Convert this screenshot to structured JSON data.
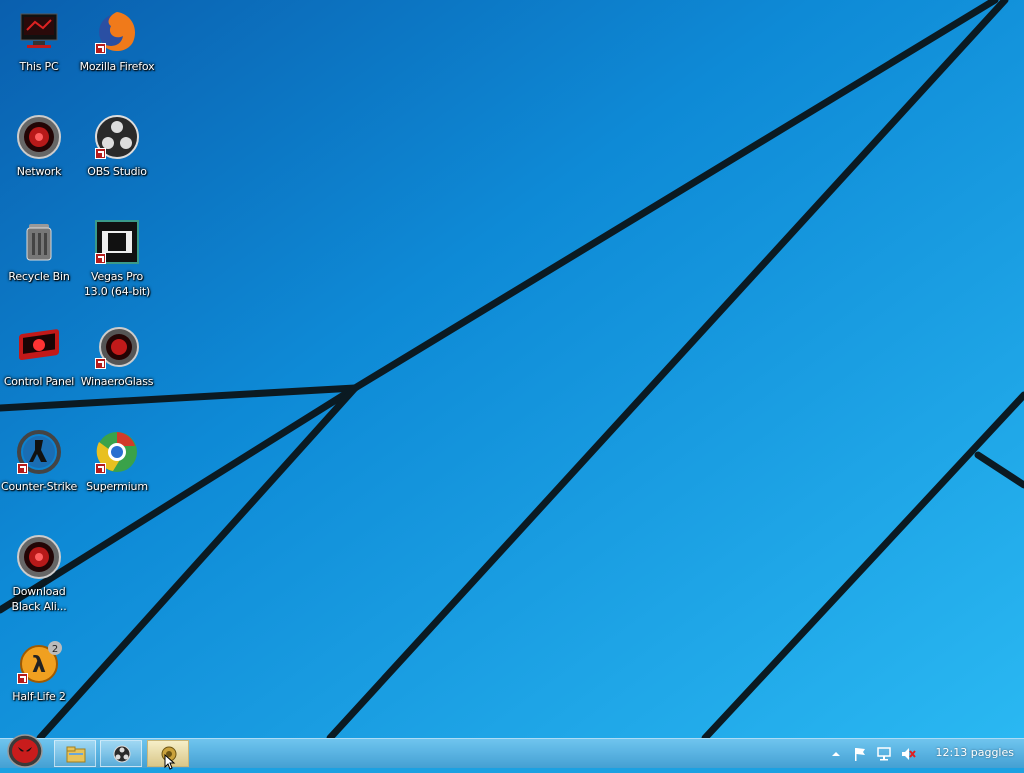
{
  "desktop": {
    "icons": [
      {
        "label": "This PC"
      },
      {
        "label": "Mozilla Firefox"
      },
      {
        "label": "Network"
      },
      {
        "label": "OBS Studio"
      },
      {
        "label": "Recycle Bin"
      },
      {
        "label": "Vegas Pro 13.0 (64-bit)"
      },
      {
        "label": "Control Panel"
      },
      {
        "label": "WinaeroGlass"
      },
      {
        "label": "Counter-Strike"
      },
      {
        "label": "Supermium"
      },
      {
        "label": "Download Black Ali..."
      },
      {
        "label": "Half-Life 2"
      }
    ]
  },
  "taskbar": {
    "start_icon": "alienware-head-icon",
    "pinned": [
      {
        "icon": "file-explorer-icon"
      },
      {
        "icon": "obs-icon"
      },
      {
        "icon": "alienware-app-icon",
        "active": true
      }
    ],
    "tray": {
      "icons": [
        "show-hidden-icons-chevron",
        "action-center-flag-icon",
        "network-icon",
        "volume-muted-icon"
      ],
      "clock": "12:13 paggles"
    }
  },
  "colors": {
    "wallpaper": "#1ba1e2",
    "accent_red": "#b51b1b"
  }
}
